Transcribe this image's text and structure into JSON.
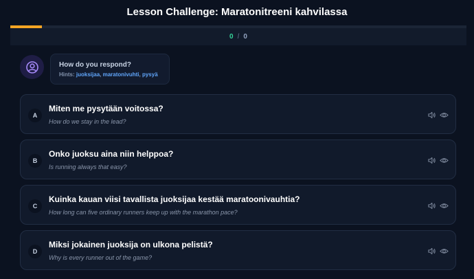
{
  "header": {
    "title": "Lesson Challenge: Maratonitreeni kahvilassa"
  },
  "progress": {
    "fraction": 0.07
  },
  "score": {
    "correct": "0",
    "separator": "/",
    "total": "0"
  },
  "prompt": {
    "title": "How do you respond?",
    "hints_label": "Hints:",
    "hints": [
      "juoksijaa",
      "maratonivuhti",
      "pysyä"
    ]
  },
  "icons": {
    "avatar": "user-circle-icon",
    "speaker": "speaker-icon",
    "eye": "eye-icon"
  },
  "colors": {
    "accent": "#f5a524",
    "correct": "#34d399",
    "hint": "#60a5fa",
    "avatar": "#a78bfa"
  },
  "options": [
    {
      "letter": "A",
      "text": "Miten me pysytään voitossa?",
      "translation": "How do we stay in the lead?"
    },
    {
      "letter": "B",
      "text": "Onko juoksu aina niin helppoa?",
      "translation": "Is running always that easy?"
    },
    {
      "letter": "C",
      "text": "Kuinka kauan viisi tavallista juoksijaa kestää maratoonivauhtia?",
      "translation": "How long can five ordinary runners keep up with the marathon pace?"
    },
    {
      "letter": "D",
      "text": "Miksi jokainen juoksija on ulkona pelistä?",
      "translation": "Why is every runner out of the game?"
    }
  ]
}
